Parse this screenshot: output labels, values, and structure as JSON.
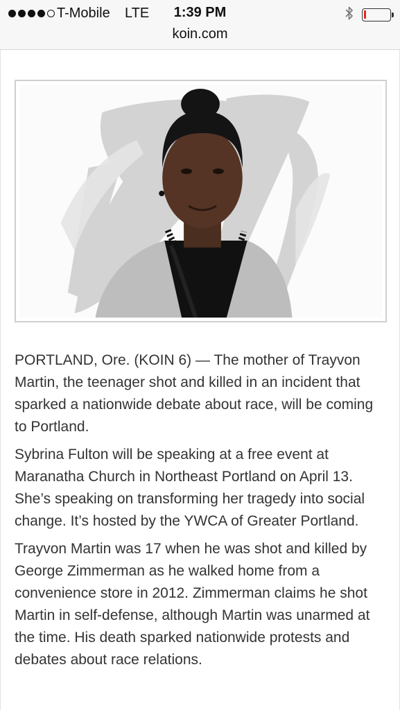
{
  "status_bar": {
    "carrier": "T-Mobile",
    "network": "LTE",
    "time": "1:39 PM",
    "signal_bars": 4,
    "signal_bars_max": 5,
    "battery_level": 0.1,
    "battery_color": "#e0281e",
    "icons": [
      "bluetooth-icon",
      "battery-icon"
    ]
  },
  "address_bar": {
    "domain": "koin.com"
  },
  "article": {
    "image": "portrait-photo",
    "paragraphs": [
      "PORTLAND, Ore. (KOIN 6) — The mother of Trayvon Martin, the teenager shot and killed in an incident that sparked a nationwide debate about race, will be coming to Portland.",
      "Sybrina Fulton will be speaking at a free event at Maranatha Church in Northeast Portland on April 13. She’s speaking on transforming her tragedy into social change. It’s hosted by the YWCA of Greater Portland.",
      "Trayvon Martin was 17 when he was shot and killed by George Zimmerman as he walked home from a convenience store in 2012. Zimmerman claims he shot Martin in self-defense, although Martin was unarmed at the time. His death sparked nationwide protests and debates about race relations."
    ]
  }
}
